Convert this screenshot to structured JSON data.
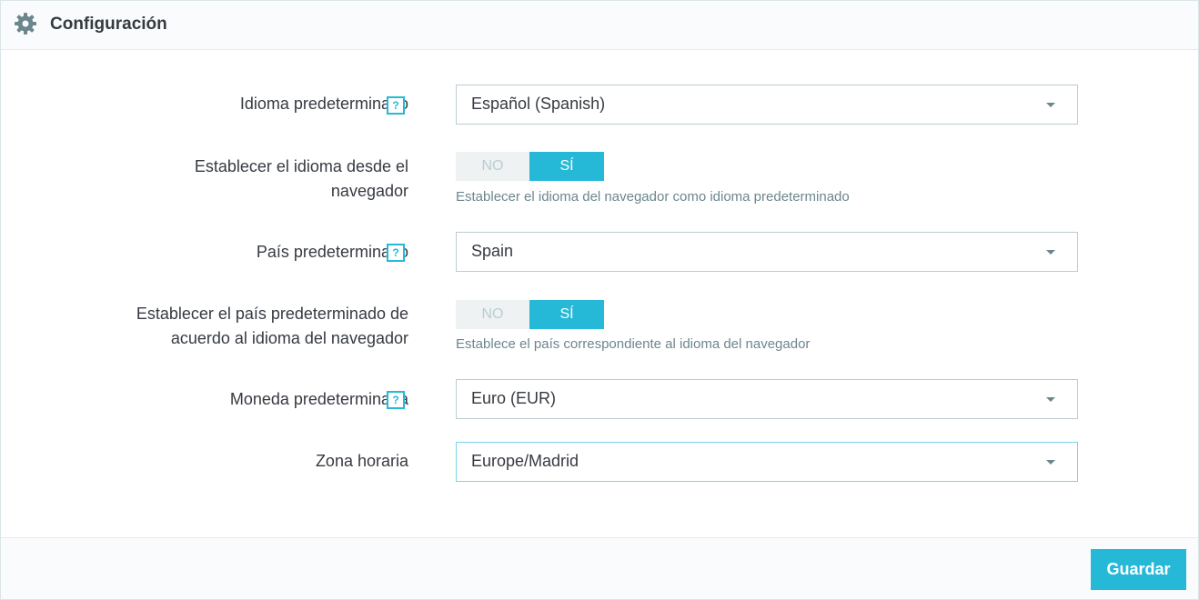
{
  "header": {
    "title": "Configuración",
    "icon": "gear-icon"
  },
  "fields": {
    "default_language": {
      "label": "Idioma predeterminado",
      "value": "Español (Spanish)",
      "help": "?"
    },
    "browser_language": {
      "label_line1": "Establecer el idioma desde el",
      "label_line2": "navegador",
      "no": "NO",
      "yes": "SÍ",
      "selected": "SÍ",
      "hint": "Establecer el idioma del navegador como idioma predeterminado"
    },
    "default_country": {
      "label": "País predeterminado",
      "value": "Spain",
      "help": "?"
    },
    "browser_country": {
      "label_line1": "Establecer el país predeterminado de",
      "label_line2": "acuerdo al idioma del navegador",
      "no": "NO",
      "yes": "SÍ",
      "selected": "SÍ",
      "hint": "Establece el país correspondiente al idioma del navegador"
    },
    "default_currency": {
      "label": "Moneda predeterminada",
      "value": "Euro (EUR)",
      "help": "?"
    },
    "timezone": {
      "label": "Zona horaria",
      "value": "Europe/Madrid"
    }
  },
  "footer": {
    "save_label": "Guardar"
  },
  "colors": {
    "accent": "#25b9d7",
    "text": "#363a41",
    "muted": "#6c868e",
    "border": "#bbcdd2"
  }
}
